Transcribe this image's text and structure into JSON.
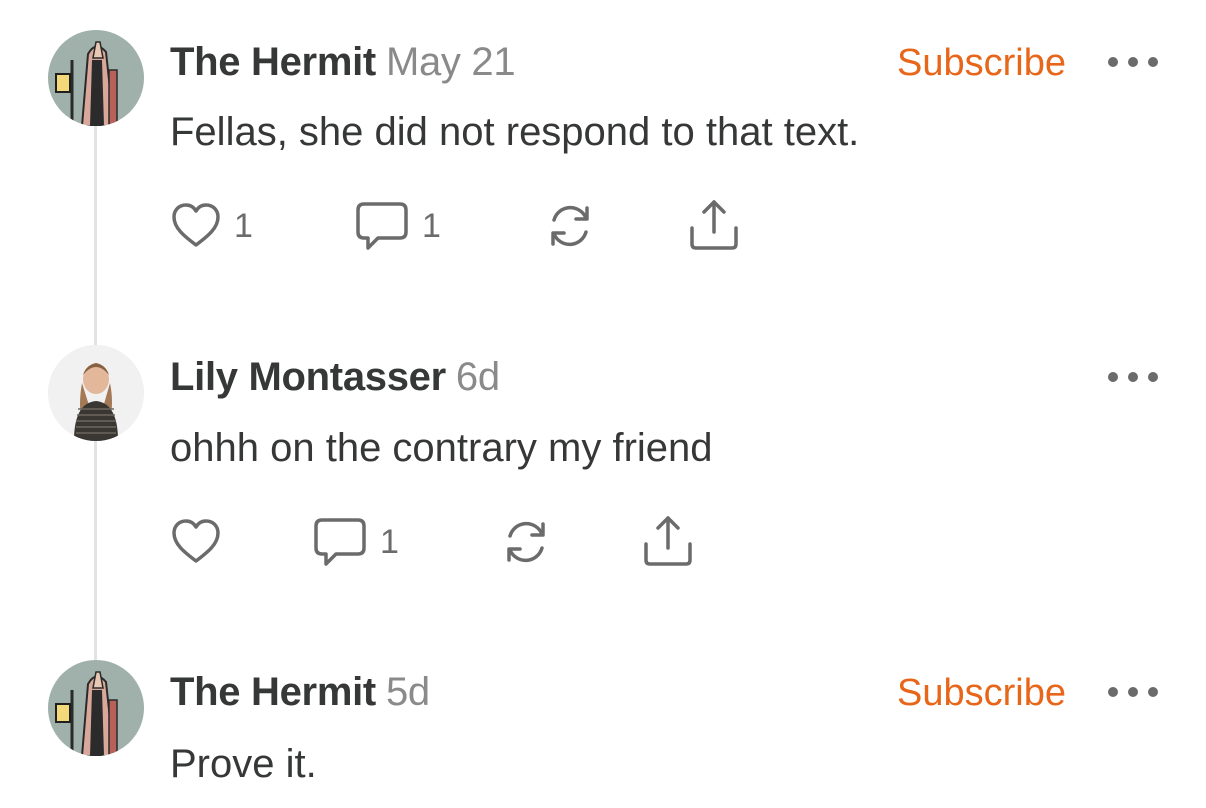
{
  "comments": [
    {
      "author": "The Hermit",
      "date": "May 21",
      "subscribe_label": "Subscribe",
      "text": "Fellas, she did not respond to that text.",
      "like_count": "1",
      "reply_count": "1"
    },
    {
      "author": "Lily Montasser",
      "date": "6d",
      "text": "ohhh on the contrary my friend",
      "reply_count": "1"
    },
    {
      "author": "The Hermit",
      "date": "5d",
      "subscribe_label": "Subscribe",
      "text": "Prove it."
    }
  ],
  "icons": {
    "like": "heart-icon",
    "reply": "speech-bubble-icon",
    "restack": "refresh-icon",
    "share": "share-icon",
    "more": "more-horizontal-icon"
  },
  "colors": {
    "accent": "#e8661a",
    "text": "#363737",
    "muted": "#8a8a8a",
    "icon": "#6b6b6b",
    "thread_line": "#e3e3e3"
  }
}
